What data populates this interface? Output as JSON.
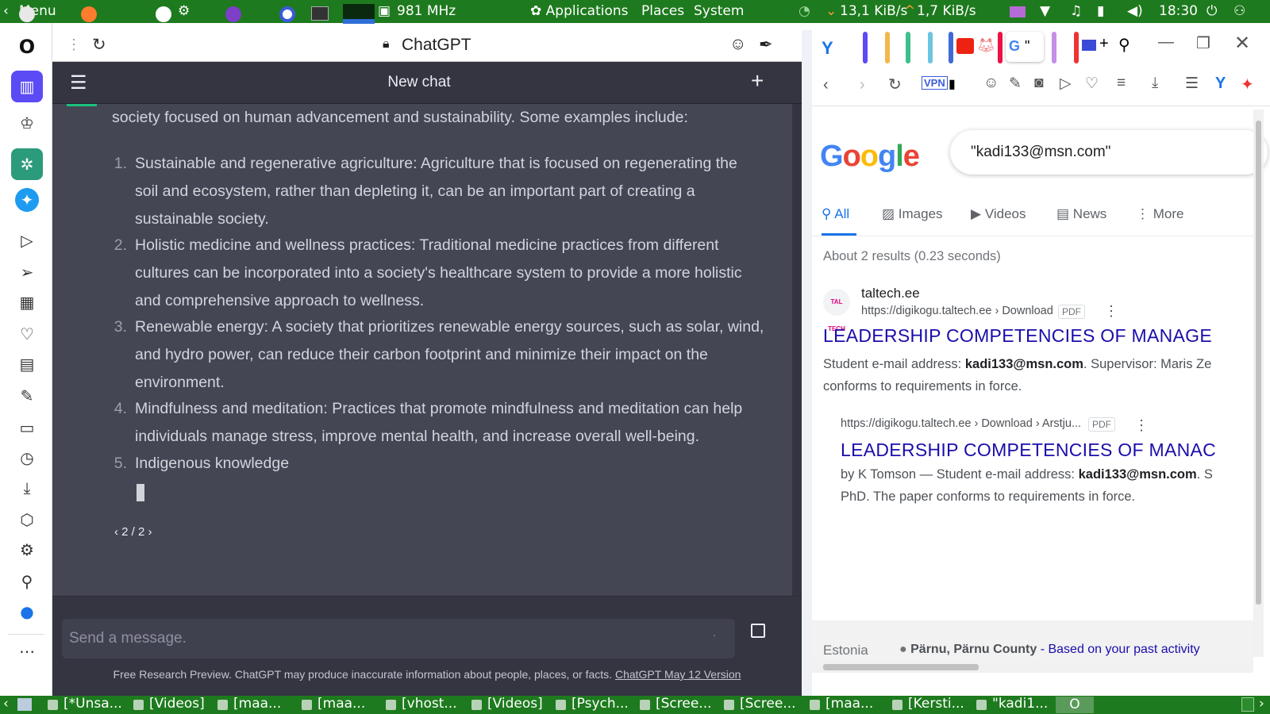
{
  "top_panel": {
    "menu_label": "Menu",
    "cpu_freq": "981 MHz",
    "applications_label": "Applications",
    "places_label": "Places",
    "system_label": "System",
    "net_down": "13,1 KiB/s",
    "net_up": "1,7 KiB/s",
    "clock": "18:30"
  },
  "chatgpt": {
    "tab_title": "ChatGPT",
    "header_title": "New chat",
    "intro_text": "society focused on human advancement and sustainability. Some examples include:",
    "list": [
      {
        "num": "1.",
        "lines": [
          "Sustainable and regenerative agriculture: Agriculture that is focused on regenerating the",
          "soil and ecosystem, rather than depleting it, can be an important part of creating a",
          "sustainable society."
        ]
      },
      {
        "num": "2.",
        "lines": [
          "Holistic medicine and wellness practices: Traditional medicine practices from different",
          "cultures can be incorporated into a society's healthcare system to provide a more holistic",
          "and comprehensive approach to wellness."
        ]
      },
      {
        "num": "3.",
        "lines": [
          "Renewable energy: A society that prioritizes renewable energy sources, such as solar, wind,",
          "and hydro power, can reduce their carbon footprint and minimize their impact on the",
          "environment."
        ]
      },
      {
        "num": "4.",
        "lines": [
          "Mindfulness and meditation: Practices that promote mindfulness and meditation can help",
          "individuals manage stress, improve mental health, and increase overall well-being."
        ]
      },
      {
        "num": "5.",
        "lines": [
          "Indigenous knowledge"
        ]
      }
    ],
    "pager": "2 / 2",
    "input_placeholder": "Send a message.",
    "footer_text": "Free Research Preview. ChatGPT may produce inaccurate information about people, places, or facts. ",
    "footer_link": "ChatGPT May 12 Version"
  },
  "right_browser": {
    "tab_quote": "\"",
    "vpn_label": "VPN",
    "search_query": "\"kadi133@msn.com\"",
    "tabs": {
      "all": "All",
      "images": "Images",
      "videos": "Videos",
      "news": "News",
      "more": "More"
    },
    "results_stats": "About 2 results (0.23 seconds)",
    "result1": {
      "site": "taltech.ee",
      "favicon_text": "TAL TECH",
      "url": "https://digikogu.taltech.ee › Download",
      "badge": "PDF",
      "title": "LEADERSHIP COMPETENCIES OF MANAGE",
      "snip1_pre": "Student e-mail address: ",
      "snip1_bold": "kadi133@msn.com",
      "snip1_post": ". Supervisor: Maris Ze",
      "snip2": "conforms to requirements in force."
    },
    "result2": {
      "url": "https://digikogu.taltech.ee › Download › Arstju...",
      "badge": "PDF",
      "title": "LEADERSHIP COMPETENCIES OF MANAC",
      "snip1_pre": "by K Tomson — Student e-mail address: ",
      "snip1_bold": "kadi133@msn.com",
      "snip1_post": ". S",
      "snip2": "PhD. The paper conforms to requirements in force."
    },
    "location_country": "Estonia",
    "location_place": "Pärnu, Pärnu County",
    "location_note": " - Based on your past activity"
  },
  "taskbar": {
    "items": [
      "[*Unsa...",
      "[Videos]",
      "[maa...",
      "[maa...",
      "[vhost...",
      "[Videos]",
      "[Psych...",
      "[Scree...",
      "[Scree...",
      "[maa...",
      "[Kersti...",
      "\"kadi1..."
    ]
  },
  "colors": {
    "panel_green": "#1e7a1e",
    "chat_bg": "#343541",
    "msg_bg": "#444654",
    "google_blue": "#1a73e8",
    "link": "#1a0dab"
  }
}
